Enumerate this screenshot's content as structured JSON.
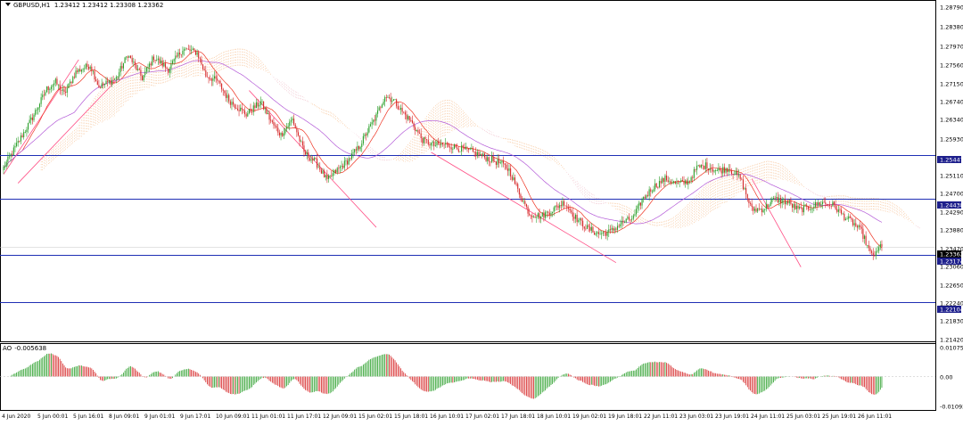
{
  "header": {
    "symbol": "GBPUSD,H1",
    "ohlc": "1.23412 1.23412 1.23308 1.23362"
  },
  "ao_header": {
    "name": "AO",
    "value": "-0.005638"
  },
  "colors": {
    "bull": "#2ca02c",
    "bear": "#d62728",
    "hline": "#1f2fb5",
    "trend": "#ff4f86",
    "ma_red": "#ee3322",
    "ma_purple": "#b45cd8",
    "cloud_orange": "#f2a05a",
    "cloud_pink": "#e8a0b0",
    "marker_bg": "#1d1f8c",
    "price_marker_bg": "#000000"
  },
  "price_axis": {
    "ticks": [
      "1.28790",
      "1.28380",
      "1.27970",
      "1.27560",
      "1.27150",
      "1.26740",
      "1.26340",
      "1.25930",
      "1.25110",
      "1.24700",
      "1.24290",
      "1.23880",
      "1.23470",
      "1.23060",
      "1.22650",
      "1.22240",
      "1.21830",
      "1.21420"
    ],
    "markers": [
      {
        "label": "1.25447",
        "kind": "level"
      },
      {
        "label": "1.24438",
        "kind": "level"
      },
      {
        "label": "1.23362",
        "kind": "price"
      },
      {
        "label": "1.23174",
        "kind": "level"
      },
      {
        "label": "1.22104",
        "kind": "level"
      }
    ]
  },
  "ao_axis": {
    "ticks": [
      "0.010751",
      "0.00",
      "-0.010929"
    ]
  },
  "time_axis": {
    "labels": [
      "4 Jun 2020",
      "5 Jun 00:01",
      "5 Jun 16:01",
      "8 Jun 09:01",
      "9 Jun 01:01",
      "9 Jun 17:01",
      "10 Jun 09:01",
      "11 Jun 01:01",
      "11 Jun 17:01",
      "12 Jun 09:01",
      "15 Jun 02:01",
      "15 Jun 18:01",
      "16 Jun 10:01",
      "17 Jun 02:01",
      "17 Jun 18:01",
      "18 Jun 10:01",
      "19 Jun 02:01",
      "19 Jun 18:01",
      "22 Jun 11:01",
      "23 Jun 03:01",
      "23 Jun 19:01",
      "24 Jun 11:01",
      "25 Jun 03:01",
      "25 Jun 19:01",
      "26 Jun 11:01"
    ]
  },
  "chart_data": {
    "type": "candlestick",
    "symbol": "GBPUSD",
    "timeframe": "H1",
    "last_bar_ohlc": [
      1.23412,
      1.23412,
      1.23308,
      1.23362
    ],
    "ylim": [
      1.2142,
      1.2879
    ],
    "horizontal_levels": [
      1.25447,
      1.24438,
      1.23174,
      1.22104
    ],
    "price_path": [
      [
        0,
        1.2515
      ],
      [
        10,
        1.2572
      ],
      [
        20,
        1.2629
      ],
      [
        30,
        1.2694
      ],
      [
        36,
        1.2709
      ],
      [
        42,
        1.2682
      ],
      [
        50,
        1.2732
      ],
      [
        60,
        1.2748
      ],
      [
        66,
        1.2698
      ],
      [
        78,
        1.2718
      ],
      [
        86,
        1.2772
      ],
      [
        96,
        1.2718
      ],
      [
        104,
        1.2766
      ],
      [
        114,
        1.2738
      ],
      [
        124,
        1.2784
      ],
      [
        134,
        1.2776
      ],
      [
        140,
        1.2724
      ],
      [
        148,
        1.2712
      ],
      [
        156,
        1.2668
      ],
      [
        168,
        1.2636
      ],
      [
        178,
        1.2664
      ],
      [
        186,
        1.2615
      ],
      [
        192,
        1.259
      ],
      [
        200,
        1.2625
      ],
      [
        208,
        1.2549
      ],
      [
        216,
        1.2528
      ],
      [
        224,
        1.2486
      ],
      [
        230,
        1.2507
      ],
      [
        238,
        1.253
      ],
      [
        246,
        1.2562
      ],
      [
        252,
        1.2598
      ],
      [
        258,
        1.2632
      ],
      [
        264,
        1.2679
      ],
      [
        270,
        1.2668
      ],
      [
        276,
        1.2642
      ],
      [
        282,
        1.262
      ],
      [
        290,
        1.2578
      ],
      [
        298,
        1.2566
      ],
      [
        306,
        1.2568
      ],
      [
        314,
        1.256
      ],
      [
        320,
        1.2555
      ],
      [
        328,
        1.2546
      ],
      [
        336,
        1.2535
      ],
      [
        344,
        1.2525
      ],
      [
        350,
        1.251
      ],
      [
        356,
        1.2465
      ],
      [
        364,
        1.2411
      ],
      [
        372,
        1.2405
      ],
      [
        380,
        1.242
      ],
      [
        388,
        1.2437
      ],
      [
        396,
        1.2402
      ],
      [
        404,
        1.2378
      ],
      [
        412,
        1.2365
      ],
      [
        420,
        1.237
      ],
      [
        428,
        1.239
      ],
      [
        436,
        1.2402
      ],
      [
        442,
        1.2442
      ],
      [
        450,
        1.2472
      ],
      [
        458,
        1.249
      ],
      [
        466,
        1.2478
      ],
      [
        474,
        1.2484
      ],
      [
        480,
        1.2515
      ],
      [
        486,
        1.252
      ],
      [
        494,
        1.2508
      ],
      [
        502,
        1.2514
      ],
      [
        510,
        1.2491
      ],
      [
        518,
        1.242
      ],
      [
        526,
        1.2422
      ],
      [
        534,
        1.2444
      ],
      [
        542,
        1.2438
      ],
      [
        550,
        1.242
      ],
      [
        558,
        1.2425
      ],
      [
        566,
        1.2436
      ],
      [
        574,
        1.2431
      ],
      [
        582,
        1.2404
      ],
      [
        588,
        1.239
      ],
      [
        594,
        1.237
      ],
      [
        600,
        1.232
      ],
      [
        604,
        1.2318
      ],
      [
        608,
        1.2345
      ]
    ],
    "price_path_x_unit": "bar index"
  }
}
